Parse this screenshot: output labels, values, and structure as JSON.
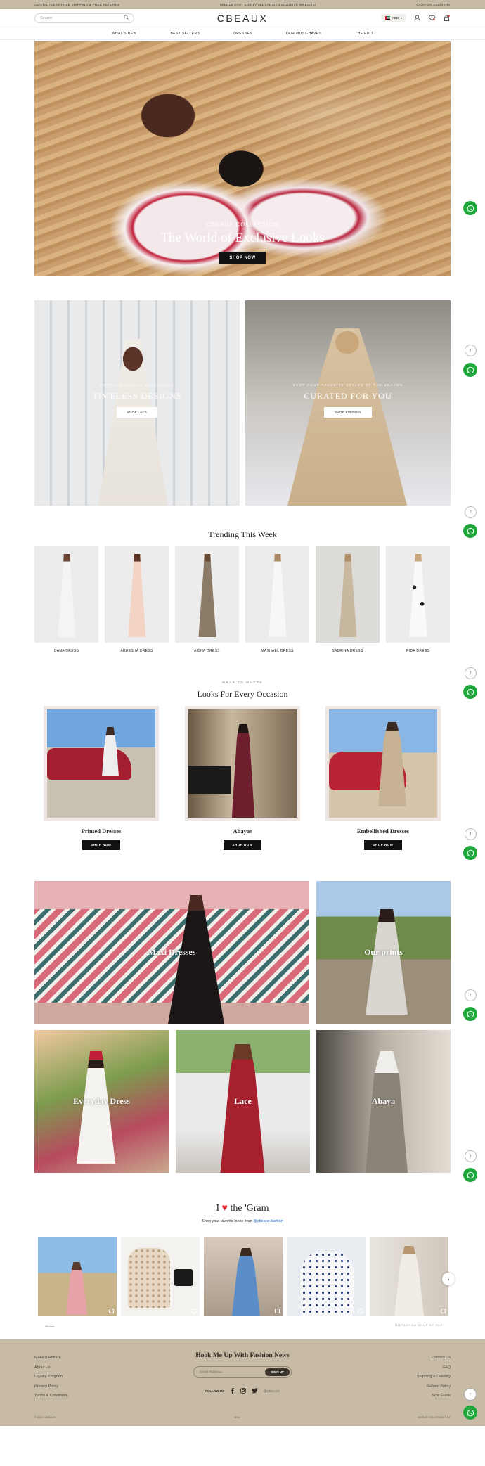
{
  "topbar": {
    "left": "CONTACTLESS FREE SHIPPING & FREE RETURNS",
    "center": "MIDDLE EAST'S ONLY ALL LADIES EXCLUSIVE WEBSITE!",
    "right": "CASH ON DELIVERY"
  },
  "header": {
    "search_placeholder": "Search",
    "logo": "CBEAUX",
    "currency": "AED",
    "icons": [
      "search-icon",
      "user-icon",
      "heart-icon",
      "bag-icon"
    ]
  },
  "nav": [
    "WHAT'S NEW",
    "BEST SELLERS",
    "DRESSES",
    "OUR MUST-HAVES",
    "THE EDIT"
  ],
  "hero": {
    "subtitle": "CBEAUX COLLECTION",
    "title": "The World of Exclusive Looks",
    "button": "SHOP NOW"
  },
  "promos": [
    {
      "subtitle": "SHOP THE CBEAUX LACE LOOKS",
      "title": "TIMELESS DESIGNS",
      "button": "SHOP LACE"
    },
    {
      "subtitle": "SHOP YOUR FAVORITE STYLES OF THE SEASON",
      "title": "CURATED FOR YOU",
      "button": "SHOP EVENING"
    }
  ],
  "trending": {
    "title": "Trending This Week",
    "items": [
      "DANA DRESS",
      "AREESHA DRESS",
      "AISHA DRESS",
      "MASHAEL DRESS",
      "SABRINA DRESS",
      "RIDA DRESS"
    ]
  },
  "occasion": {
    "eyebrow": "WEAR TO WHERE",
    "title": "Looks For Every Occasion",
    "items": [
      {
        "name": "Printed Dresses",
        "button": "SHOP NOW"
      },
      {
        "name": "Abayas",
        "button": "SHOP NOW"
      },
      {
        "name": "Embellished Dresses",
        "button": "SHOP NOW"
      }
    ]
  },
  "categories": [
    "Maxi Dresses",
    "Our prints",
    "Everyday Dress",
    "Lace",
    "Abaya"
  ],
  "gram": {
    "title_prefix": "I",
    "title_suffix": "the 'Gram",
    "subtitle_prefix": "Shop your favorite looks from",
    "handle": "@cbeaux.fashion",
    "footer_left": "Albums",
    "footer_right": "INSTAGRAM SHOP BY SNPT"
  },
  "footer": {
    "left_links": [
      "Make a Return",
      "About Us",
      "Loyalty Program",
      "Privacy Policy",
      "Terms & Conditions"
    ],
    "heading": "Hook Me Up With Fashion News",
    "email_placeholder": "Email Address",
    "signup": "SIGN UP",
    "follow": "FOLLOW US",
    "handle": "@CBEAUX",
    "right_links": [
      "Contact Us",
      "FAQ",
      "Shipping & Delivery",
      "Refund Policy",
      "Size Guide"
    ],
    "copyright": "© 2021 CBEAUX",
    "middle": "SKU",
    "credit": "WEB DEVELOPMENT BY"
  },
  "colors": {
    "topbar": "#c7bba6",
    "whatsapp": "#1ea83c",
    "heart": "#e0202c",
    "link": "#1c6fd1"
  }
}
